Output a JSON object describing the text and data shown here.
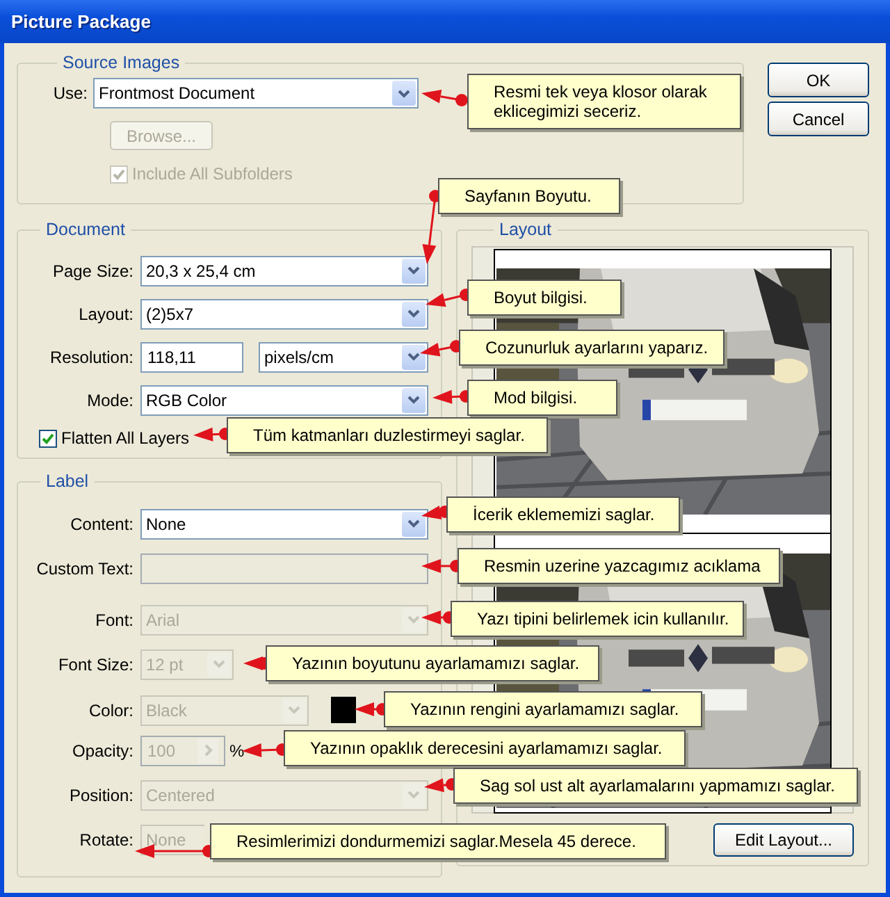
{
  "window": {
    "title": "Picture Package"
  },
  "source_images": {
    "legend": "Source Images",
    "use": {
      "label": "Use:",
      "value": "Frontmost Document",
      "disabled": false
    },
    "browse_button": {
      "label": "Browse...",
      "disabled": true
    },
    "include_subfolders": {
      "label": "Include All Subfolders",
      "checked": true,
      "disabled": true
    }
  },
  "buttons": [
    {
      "label": "OK"
    },
    {
      "label": "Cancel"
    }
  ],
  "document": {
    "legend": "Document",
    "fields": [
      {
        "kind": "select",
        "label": "Page Size:",
        "value": "20,3 x 25,4 cm",
        "disabled": false
      },
      {
        "kind": "select",
        "label": "Layout:",
        "value": "(2)5x7",
        "disabled": false
      },
      {
        "kind": "unit",
        "label": "Resolution:",
        "value": "118,11",
        "unit": "pixels/cm",
        "disabled": false
      },
      {
        "kind": "select",
        "label": "Mode:",
        "value": "RGB Color",
        "disabled": false
      }
    ],
    "flatten": {
      "label": "Flatten All Layers",
      "checked": true,
      "disabled": false
    }
  },
  "label_section": {
    "legend": "Label",
    "fields": [
      {
        "kind": "select",
        "label": "Content:",
        "value": "None",
        "disabled": false
      },
      {
        "kind": "text",
        "label": "Custom Text:",
        "disabled": true
      },
      {
        "kind": "select",
        "label": "Font:",
        "value": "Arial",
        "disabled": true
      },
      {
        "kind": "small",
        "label": "Font Size:",
        "value": "12 pt",
        "disabled": true
      },
      {
        "kind": "color",
        "label": "Color:",
        "value": "Black",
        "disabled": true,
        "color": "#000000"
      },
      {
        "kind": "spin",
        "label": "Opacity:",
        "value": "100",
        "suffix": "%",
        "disabled": true
      },
      {
        "kind": "select",
        "label": "Position:",
        "value": "Centered",
        "disabled": true
      },
      {
        "kind": "cut",
        "label": "Rotate:",
        "value": "None",
        "disabled": true
      }
    ]
  },
  "layout": {
    "legend": "Layout",
    "edit_button": "Edit Layout..."
  },
  "callouts": [
    {
      "text": "Resmi tek veya klosor olarak eklicegimizi seceriz."
    },
    {
      "text": "Sayfanın Boyutu."
    },
    {
      "text": "Boyut bilgisi."
    },
    {
      "text": "Cozunurluk ayarlarını yaparız."
    },
    {
      "text": "Mod bilgisi."
    },
    {
      "text": "Tüm katmanları duzlestirmeyi saglar."
    },
    {
      "text": "İcerik eklememizi saglar."
    },
    {
      "text": "Resmin uzerine yazcagımız acıklama"
    },
    {
      "text": "Yazı tipini belirlemek icin kullanılır."
    },
    {
      "text": "Yazının boyutunu ayarlamamızı saglar."
    },
    {
      "text": "Yazının rengini ayarlamamızı saglar."
    },
    {
      "text": "Yazının opaklık derecesini ayarlamamızı saglar."
    },
    {
      "text": "Sag sol ust alt ayarlamalarını yapmamızı saglar."
    },
    {
      "text": "Resimlerimizi dondurmemizi saglar.Mesela 45 derece."
    }
  ]
}
